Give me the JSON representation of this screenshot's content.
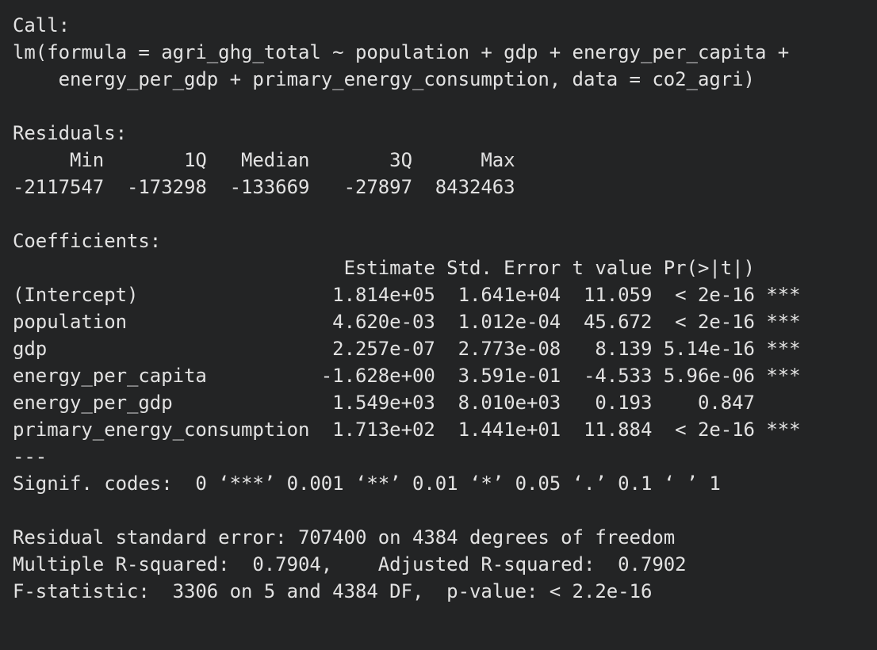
{
  "output": {
    "call_header": "Call:",
    "call_line1": "lm(formula = agri_ghg_total ~ population + gdp + energy_per_capita +",
    "call_line2": "    energy_per_gdp + primary_energy_consumption, data = co2_agri)",
    "residuals_header": "Residuals:",
    "residuals_labels": "     Min       1Q   Median       3Q      Max ",
    "residuals_values": "-2117547  -173298  -133669   -27897  8432463 ",
    "coefficients_header": "Coefficients:",
    "coef_columns": "                             Estimate Std. Error t value Pr(>|t|)    ",
    "coef_rows": [
      "(Intercept)                 1.814e+05  1.641e+04  11.059  < 2e-16 ***",
      "population                  4.620e-03  1.012e-04  45.672  < 2e-16 ***",
      "gdp                         2.257e-07  2.773e-08   8.139 5.14e-16 ***",
      "energy_per_capita          -1.628e+00  3.591e-01  -4.533 5.96e-06 ***",
      "energy_per_gdp              1.549e+03  8.010e+03   0.193    0.847    ",
      "primary_energy_consumption  1.713e+02  1.441e+01  11.884  < 2e-16 ***"
    ],
    "separator": "---",
    "signif_codes": "Signif. codes:  0 ‘***’ 0.001 ‘**’ 0.01 ‘*’ 0.05 ‘.’ 0.1 ‘ ’ 1",
    "residual_se": "Residual standard error: 707400 on 4384 degrees of freedom",
    "r_squared": "Multiple R-squared:  0.7904,\tAdjusted R-squared:  0.7902 ",
    "f_statistic": "F-statistic:  3306 on 5 and 4384 DF,  p-value: < 2.2e-16"
  }
}
